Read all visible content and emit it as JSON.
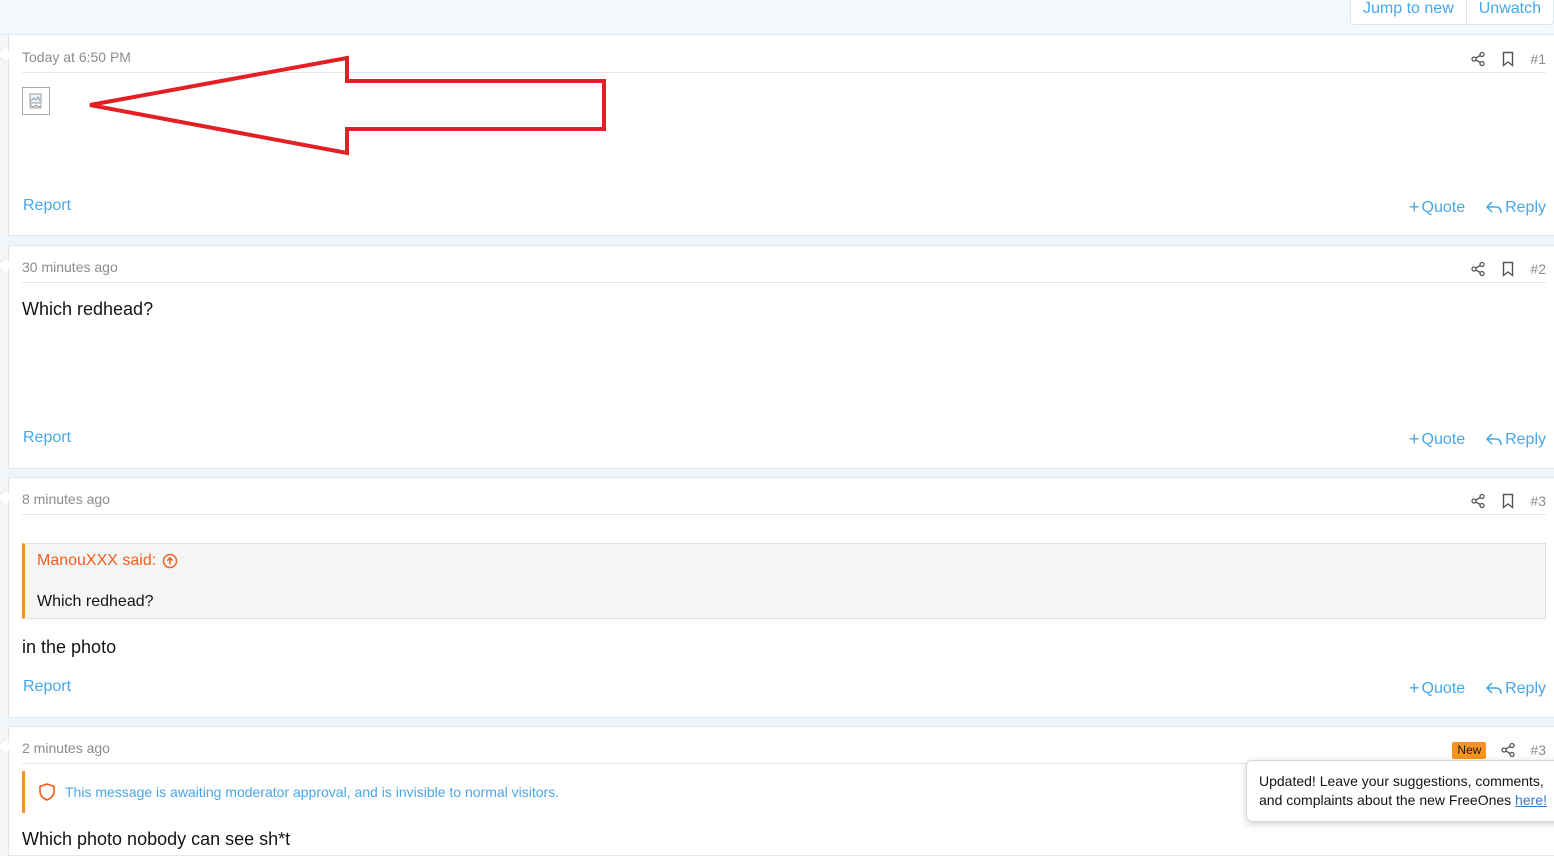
{
  "topbar": {
    "jump_label": "Jump to new",
    "unwatch_label": "Unwatch"
  },
  "posts": [
    {
      "date": "Today at 6:50 PM",
      "number": "#1",
      "report": "Report",
      "quote": "Quote",
      "reply": "Reply"
    },
    {
      "date": "30 minutes ago",
      "number": "#2",
      "body": "Which redhead?",
      "report": "Report",
      "quote": "Quote",
      "reply": "Reply"
    },
    {
      "date": "8 minutes ago",
      "number": "#3",
      "quote_block": {
        "author": "ManouXXX said:",
        "text": "Which redhead?"
      },
      "body": "in the photo",
      "report": "Report",
      "quote": "Quote",
      "reply": "Reply"
    },
    {
      "date": "2 minutes ago",
      "number": "#3",
      "badge": "New",
      "moderation": "This message is awaiting moderator approval, and is invisible to normal visitors.",
      "body": "Which photo nobody can see sh*t"
    }
  ],
  "toast": {
    "text": "Updated! Leave your suggestions, comments, and complaints about the new FreeOnes",
    "link": "here!"
  },
  "colors": {
    "link": "#47a7eb",
    "accent_orange": "#f7941d",
    "annotation_red": "#e31e24"
  },
  "icons": [
    "share-icon",
    "bookmark-icon",
    "plus-icon",
    "reply-icon",
    "broken-image-icon",
    "arrow-up-circle-icon",
    "shield-icon"
  ]
}
